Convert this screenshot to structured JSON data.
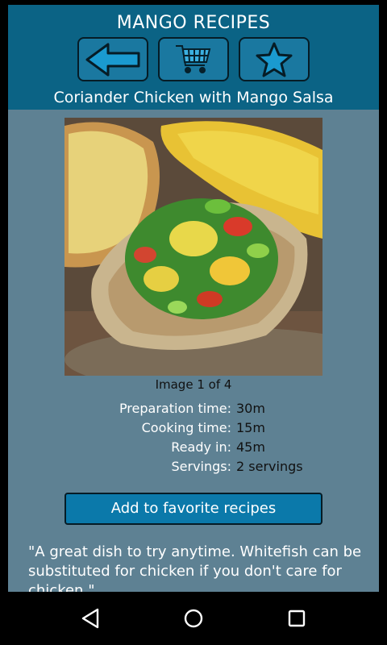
{
  "app": {
    "title": "MANGO RECIPES"
  },
  "toolbar": {
    "back_icon": "back-arrow-icon",
    "cart_icon": "shopping-cart-icon",
    "favorite_icon": "star-icon"
  },
  "recipe": {
    "title": "Coriander Chicken with Mango Salsa",
    "image_caption": "Image 1 of 4",
    "details": [
      {
        "label": "Preparation time:",
        "value": "30m"
      },
      {
        "label": "Cooking time:",
        "value": "15m"
      },
      {
        "label": "Ready in:",
        "value": "45m"
      },
      {
        "label": "Servings:",
        "value": "2 servings"
      }
    ],
    "add_favorite_label": "Add to favorite recipes",
    "description": "\"A great dish to try anytime. Whitefish can be substituted for chicken if you don't care for chicken.\""
  },
  "navigation": {
    "back_icon": "nav-back-icon",
    "home_icon": "nav-home-icon",
    "recents_icon": "nav-recents-icon"
  },
  "colors": {
    "header": "#0b6385",
    "background": "#5e8193",
    "button": "#0b79aa"
  }
}
